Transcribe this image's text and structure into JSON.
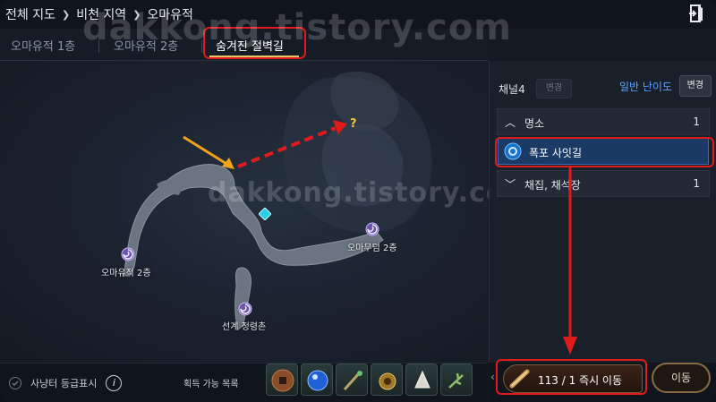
{
  "header": {
    "breadcrumb": [
      "전체 지도",
      "비천 지역",
      "오마유적"
    ],
    "exit_icon": "exit-door-icon"
  },
  "tabs": [
    {
      "label": "오마유적 1층",
      "active": false
    },
    {
      "label": "오마유적 2층",
      "active": false
    },
    {
      "label": "숨겨진 절벽길",
      "active": true
    }
  ],
  "watermark": {
    "top": "dakkong.tistory.com",
    "middle": "dakkong.tistory.com"
  },
  "map": {
    "locations": [
      {
        "label": "오마유적 2층"
      },
      {
        "label": "오마무덤 2층"
      },
      {
        "label": "선계 정령촌"
      }
    ],
    "icons": [
      "portal-icon",
      "waypoint-icon",
      "quest-marker-icon"
    ]
  },
  "panel": {
    "channel": "채널4",
    "channel_change": "변경",
    "difficulty": "일반 난이도",
    "difficulty_change": "변경",
    "sections": [
      {
        "label": "명소",
        "count": "1",
        "expanded": true
      },
      {
        "label": "채집, 채석장",
        "count": "1",
        "expanded": false
      }
    ],
    "selected_item": "폭포 사잇길"
  },
  "bottom": {
    "hunter_label": "사냥터 등급표시",
    "acquire_label": "획득 가능 목록",
    "items": [
      "coin-icon",
      "blue-orb-icon",
      "staff-icon",
      "amulet-icon",
      "horn-icon",
      "branch-icon"
    ]
  },
  "teleport": {
    "text": "113 /   1 즉시 이동",
    "move_label": "이동"
  },
  "colors": {
    "highlight": "#e01b1b",
    "accent_blue": "#5ea0ff",
    "selected_bg": "#1b3a66"
  }
}
